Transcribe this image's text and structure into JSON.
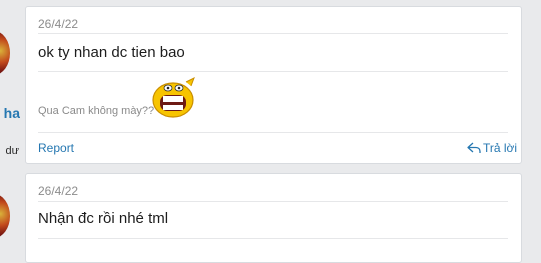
{
  "posts": [
    {
      "author": {
        "name_visible": "ha",
        "title_visible": "dư"
      },
      "date": "26/4/22",
      "body": "ok ty nhan dc tien bao",
      "signature": "Qua Cam không mày??",
      "emoji_icon": "laughing-face-icon",
      "actions": {
        "report": "Report",
        "reply": "Trả lời"
      }
    },
    {
      "date": "26/4/22",
      "body": "Nhận đc rồi nhé tml"
    }
  ],
  "colors": {
    "link": "#2577b1",
    "background": "#e9eaec",
    "card": "#ffffff"
  }
}
